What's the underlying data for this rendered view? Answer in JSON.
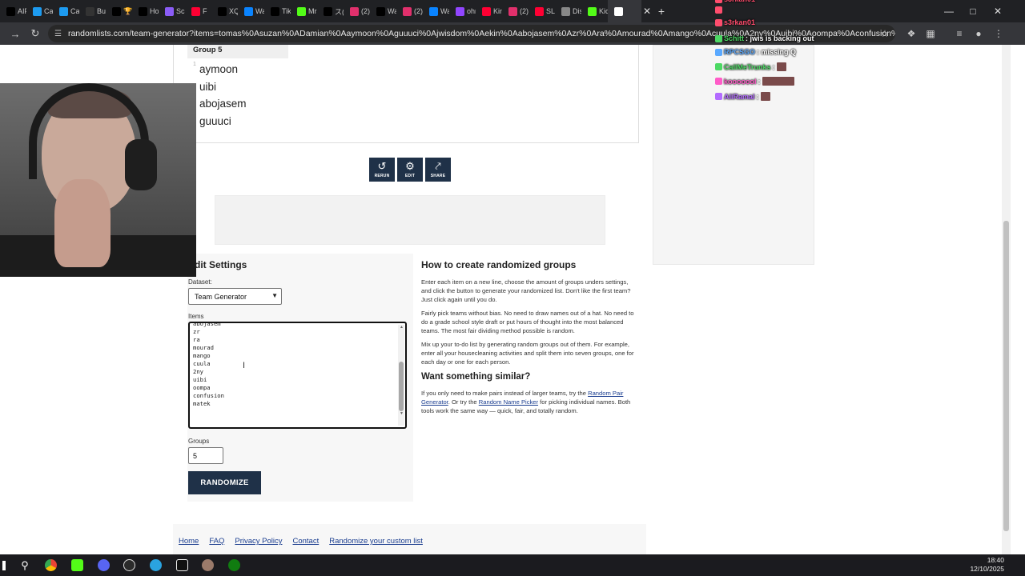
{
  "browser": {
    "tabs": [
      {
        "label": "AIPA",
        "icon": "x-icon",
        "color": "#000000"
      },
      {
        "label": "Call",
        "icon": "bird-icon",
        "color": "#1d9bf0"
      },
      {
        "label": "Call",
        "icon": "bird-icon",
        "color": "#1d9bf0"
      },
      {
        "label": "Buy",
        "icon": "pin-icon",
        "color": "#333333"
      },
      {
        "label": "🏆",
        "icon": "x-icon",
        "color": "#000000"
      },
      {
        "label": "Hor",
        "icon": "x-icon",
        "color": "#000000"
      },
      {
        "label": "Scr",
        "icon": "feather-icon",
        "color": "#8a5cf6"
      },
      {
        "label": "F",
        "icon": "youtube-icon",
        "color": "#ff0033"
      },
      {
        "label": "XQ",
        "icon": "tiktok-icon",
        "color": "#000000"
      },
      {
        "label": "Wa",
        "icon": "chat-icon",
        "color": "#0a84ff"
      },
      {
        "label": "TikT",
        "icon": "tiktok-icon",
        "color": "#000000"
      },
      {
        "label": "Mrs",
        "icon": "kick-icon",
        "color": "#53fc18"
      },
      {
        "label": "ス(",
        "icon": "tiktok-icon",
        "color": "#000000"
      },
      {
        "label": "(2)",
        "icon": "instagram-icon",
        "color": "#e1306c"
      },
      {
        "label": "Wa",
        "icon": "tiktok-icon",
        "color": "#000000"
      },
      {
        "label": "(2)",
        "icon": "instagram-icon",
        "color": "#e1306c"
      },
      {
        "label": "Wa",
        "icon": "chat-icon",
        "color": "#0a84ff"
      },
      {
        "label": "ohn",
        "icon": "twitch-icon",
        "color": "#9146ff"
      },
      {
        "label": "King",
        "icon": "youtube-icon",
        "color": "#ff0033"
      },
      {
        "label": "(2)",
        "icon": "instagram-icon",
        "color": "#e1306c"
      },
      {
        "label": "SL",
        "icon": "youtube-icon",
        "color": "#ff0033"
      },
      {
        "label": "Disc",
        "icon": "globe-icon",
        "color": "#888888"
      },
      {
        "label": "Kick",
        "icon": "kick-icon",
        "color": "#53fc18"
      },
      {
        "label": "",
        "icon": "randomlists-icon",
        "color": "#ffffff"
      }
    ],
    "url": "randomlists.com/team-generator?items=tomas%0Asuzan%0ADamian%0Aaymoon%0Aguuuci%0Ajwisdom%0Aekin%0Aabojasem%0Azr%0Ara%0Amourad%0Amango%0Acuula%0A2ny%0Auibi%0Aoompa%0Aconfusion%0Amatek%0A%0A&gr..."
  },
  "results": {
    "group_title": "Group 5",
    "group_index": "1",
    "members": [
      "aymoon",
      "uibi",
      "abojasem",
      "guuuci"
    ]
  },
  "actions": {
    "rerun": "RERUN",
    "edit": "EDIT",
    "share": "SHARE"
  },
  "settings": {
    "title": "dit Settings",
    "dataset_label": "Dataset:",
    "dataset_value": "Team Generator",
    "items_label": "Items",
    "items_lines": [
      "abojasem",
      "zr",
      "ra",
      "mourad",
      "mango",
      "cuula",
      "2ny",
      "uibi",
      "oompa",
      "confusion",
      "matek"
    ],
    "groups_label": "Groups",
    "groups_value": "5",
    "randomize_label": "RANDOMIZE"
  },
  "info": {
    "heading": "How to create randomized groups",
    "p1": "Enter each item on a new line, choose the amount of groups unders settings, and click the button to generate your randomized list. Don't like the first team? Just click again until you do.",
    "p2": "Fairly pick teams without bias. No need to draw names out of a hat. No need to do a grade school style draft or put hours of thought into the most balanced teams. The most fair dividing method possible is random.",
    "p3": "Mix up your to-do list by generating random groups out of them. For example, enter all your housecleaning activities and split them into seven groups, one for each day or one for each person.",
    "similar_heading": "Want something similar?",
    "similar_pre": "If you only need to make pairs instead of larger teams, try the ",
    "similar_link1": "Random Pair Generator",
    "similar_mid": ". Or try the ",
    "similar_link2": "Random Name Picker",
    "similar_post": " for picking individual names. Both tools work the same way — quick, fair, and totally random."
  },
  "footer": {
    "links": [
      "Home",
      "FAQ",
      "Privacy Policy",
      "Contact",
      "Randomize your custom list"
    ]
  },
  "chat": [
    {
      "user": "s3rkan01",
      "text": "",
      "color": "#ff4d6d"
    },
    {
      "user": "",
      "text": "",
      "color": "#ff4d6d"
    },
    {
      "user": "s3rkan01",
      "text": "",
      "color": "#ff4d6d"
    },
    {
      "user": "Schitt",
      "text": ": jwis is backing out",
      "color": "#4cd964"
    },
    {
      "user": "RPCSGO",
      "text": ": missing Q",
      "color": "#5aa9ff"
    },
    {
      "user": "CallMeTrunks",
      "text": ":",
      "color": "#4cd964"
    },
    {
      "user": "kooooool",
      "text": ":",
      "color": "#ff5cc8"
    },
    {
      "user": "AliRamal",
      "text": ":",
      "color": "#b36bff"
    }
  ],
  "taskbar": {
    "time": "18:40",
    "date": "12/10/2025"
  }
}
